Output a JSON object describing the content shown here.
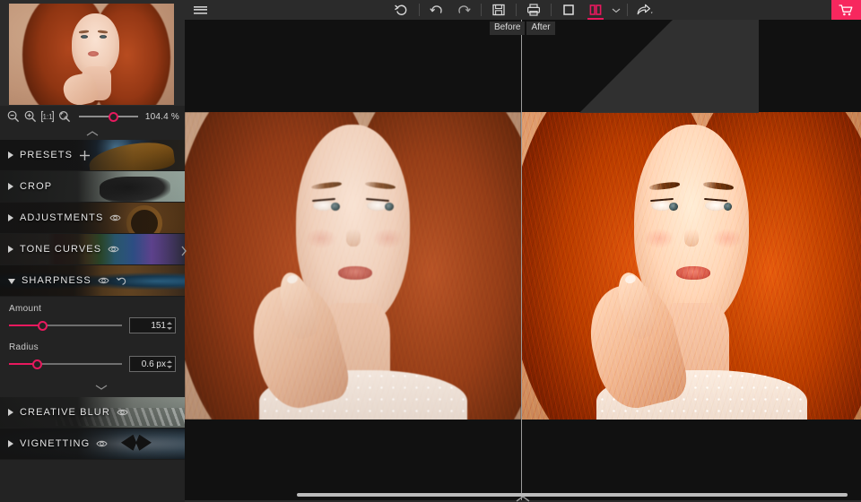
{
  "app": {
    "accent_pink": "#e8195e",
    "cart_pink": "#f7275e",
    "panel_bg": "#232323",
    "canvas_bg": "#111111"
  },
  "toolbar": {
    "menu_label": "Menu",
    "buttons": [
      {
        "name": "reset-all",
        "label": "Reset All"
      },
      {
        "name": "undo",
        "label": "Undo"
      },
      {
        "name": "redo",
        "label": "Redo"
      },
      {
        "name": "save",
        "label": "Save"
      },
      {
        "name": "print",
        "label": "Print"
      },
      {
        "name": "single-view",
        "label": "Single View"
      },
      {
        "name": "split-view",
        "label": "Split View"
      }
    ],
    "view_dropdown_label": "View options",
    "share_label": "Share",
    "cart_label": "Cart",
    "active_view": "split-view"
  },
  "viewer": {
    "before_label": "Before",
    "after_label": "After"
  },
  "zoom": {
    "value_label": "104.4 %",
    "slider_percent": 58,
    "icons": [
      {
        "name": "zoom-out-icon",
        "label": "Zoom Out"
      },
      {
        "name": "zoom-in-icon",
        "label": "Zoom In"
      },
      {
        "name": "actual-size-icon",
        "label": "1:1"
      },
      {
        "name": "fit-to-screen-icon",
        "label": "Fit To Screen"
      }
    ]
  },
  "sections": [
    {
      "key": "presets",
      "label": "PRESETS",
      "expanded": false,
      "has_add": true,
      "has_eye": false,
      "has_reset": false,
      "bg": "bg-presets"
    },
    {
      "key": "crop",
      "label": "CROP",
      "expanded": false,
      "has_add": false,
      "has_eye": false,
      "has_reset": false,
      "bg": "bg-crop"
    },
    {
      "key": "adjust",
      "label": "ADJUSTMENTS",
      "expanded": false,
      "has_add": false,
      "has_eye": true,
      "has_reset": false,
      "bg": "bg-adjust"
    },
    {
      "key": "tone",
      "label": "TONE CURVES",
      "expanded": false,
      "has_add": false,
      "has_eye": true,
      "has_reset": false,
      "bg": "bg-tone"
    },
    {
      "key": "sharpness",
      "label": "SHARPNESS",
      "expanded": true,
      "has_add": false,
      "has_eye": true,
      "has_reset": true,
      "bg": "bg-sharp"
    },
    {
      "key": "blur",
      "label": "CREATIVE BLUR",
      "expanded": false,
      "has_add": false,
      "has_eye": true,
      "has_reset": false,
      "bg": "bg-blur"
    },
    {
      "key": "vignette",
      "label": "VIGNETTING",
      "expanded": false,
      "has_add": false,
      "has_eye": true,
      "has_reset": false,
      "bg": "bg-vign"
    }
  ],
  "sharpness_controls": {
    "amount": {
      "label": "Amount",
      "value": "151",
      "slider_percent": 30
    },
    "radius": {
      "label": "Radius",
      "value": "0.6 px",
      "slider_percent": 25
    }
  }
}
